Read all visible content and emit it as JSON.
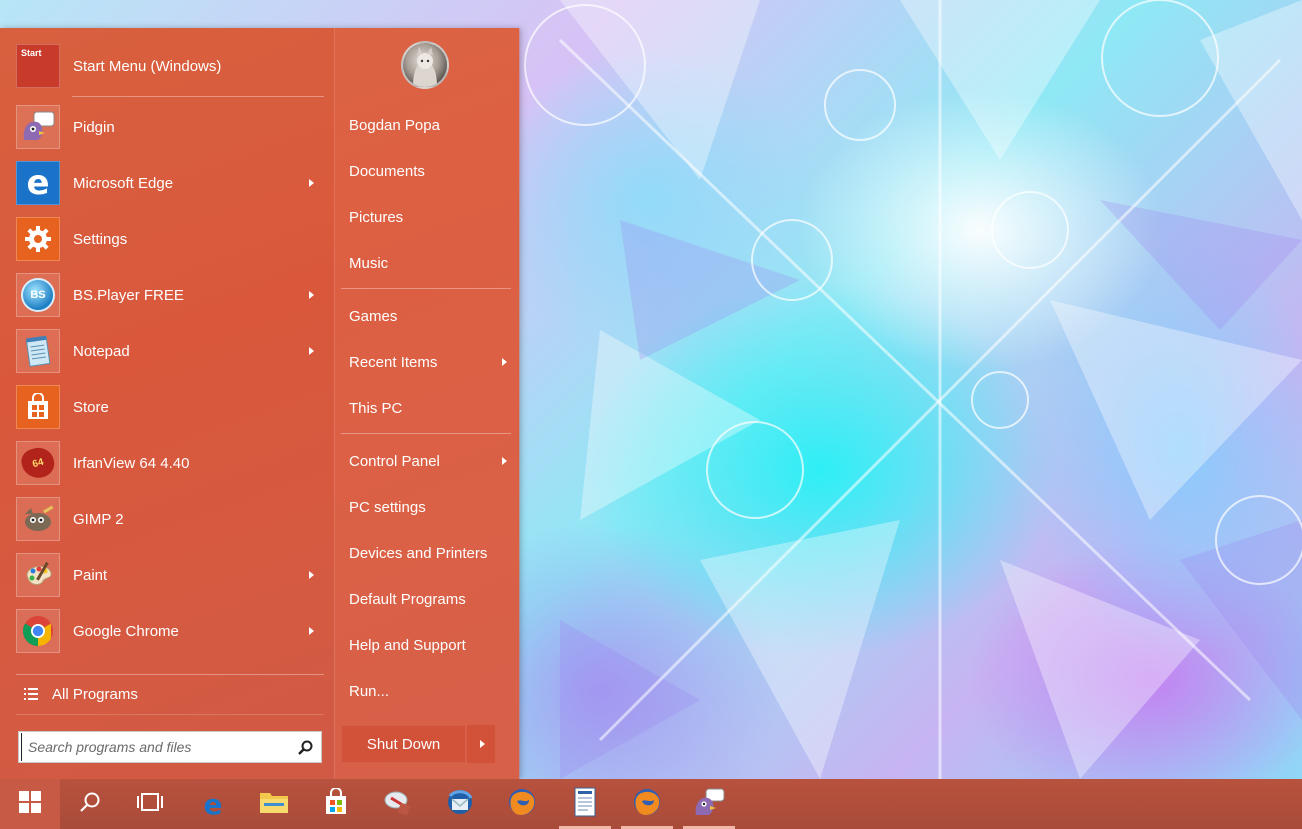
{
  "start_menu": {
    "programs": [
      {
        "label": "Start Menu (Windows)",
        "icon": "start-menu-app-icon",
        "submenu": false
      },
      {
        "label": "Pidgin",
        "icon": "pidgin-icon",
        "submenu": false
      },
      {
        "label": "Microsoft Edge",
        "icon": "edge-icon",
        "submenu": true
      },
      {
        "label": "Settings",
        "icon": "settings-gear-icon",
        "submenu": false
      },
      {
        "label": "BS.Player FREE",
        "icon": "bsplayer-icon",
        "submenu": true
      },
      {
        "label": "Notepad",
        "icon": "notepad-icon",
        "submenu": true
      },
      {
        "label": "Store",
        "icon": "store-icon",
        "submenu": false
      },
      {
        "label": "IrfanView 64 4.40",
        "icon": "irfanview-icon",
        "submenu": false
      },
      {
        "label": "GIMP 2",
        "icon": "gimp-icon",
        "submenu": false
      },
      {
        "label": "Paint",
        "icon": "paint-icon",
        "submenu": true
      },
      {
        "label": "Google Chrome",
        "icon": "chrome-icon",
        "submenu": true
      }
    ],
    "start_app_icon_text": "Start",
    "irfanview_badge": "64",
    "bsplayer_badge": "BS",
    "all_programs": "All Programs",
    "search": {
      "placeholder": "Search programs and files",
      "value": ""
    },
    "places": [
      {
        "label": "Bogdan Popa",
        "submenu": false
      },
      {
        "label": "Documents",
        "submenu": false
      },
      {
        "label": "Pictures",
        "submenu": false
      },
      {
        "label": "Music",
        "submenu": false
      },
      {
        "label": "Games",
        "submenu": false
      },
      {
        "label": "Recent Items",
        "submenu": true
      },
      {
        "label": "This PC",
        "submenu": false
      },
      {
        "label": "Control Panel",
        "submenu": true
      },
      {
        "label": "PC settings",
        "submenu": false
      },
      {
        "label": "Devices and Printers",
        "submenu": false
      },
      {
        "label": "Default Programs",
        "submenu": false
      },
      {
        "label": "Help and Support",
        "submenu": false
      },
      {
        "label": "Run...",
        "submenu": false
      }
    ],
    "shutdown": "Shut Down"
  },
  "taskbar": {
    "items": [
      {
        "icon": "windows-logo-icon",
        "running": false
      },
      {
        "icon": "search-icon",
        "running": false
      },
      {
        "icon": "task-view-icon",
        "running": false
      },
      {
        "icon": "edge-icon",
        "running": false
      },
      {
        "icon": "file-explorer-icon",
        "running": false
      },
      {
        "icon": "store-icon",
        "running": false
      },
      {
        "icon": "network-tool-icon",
        "running": false
      },
      {
        "icon": "thunderbird-icon",
        "running": false
      },
      {
        "icon": "firefox-icon",
        "running": false
      },
      {
        "icon": "document-viewer-icon",
        "running": true
      },
      {
        "icon": "firefox-icon",
        "running": true
      },
      {
        "icon": "pidgin-icon",
        "running": true
      }
    ]
  },
  "colors": {
    "menu_accent": "#d9583c",
    "taskbar": "#ad4d3b",
    "start_button": "#c65a44"
  }
}
